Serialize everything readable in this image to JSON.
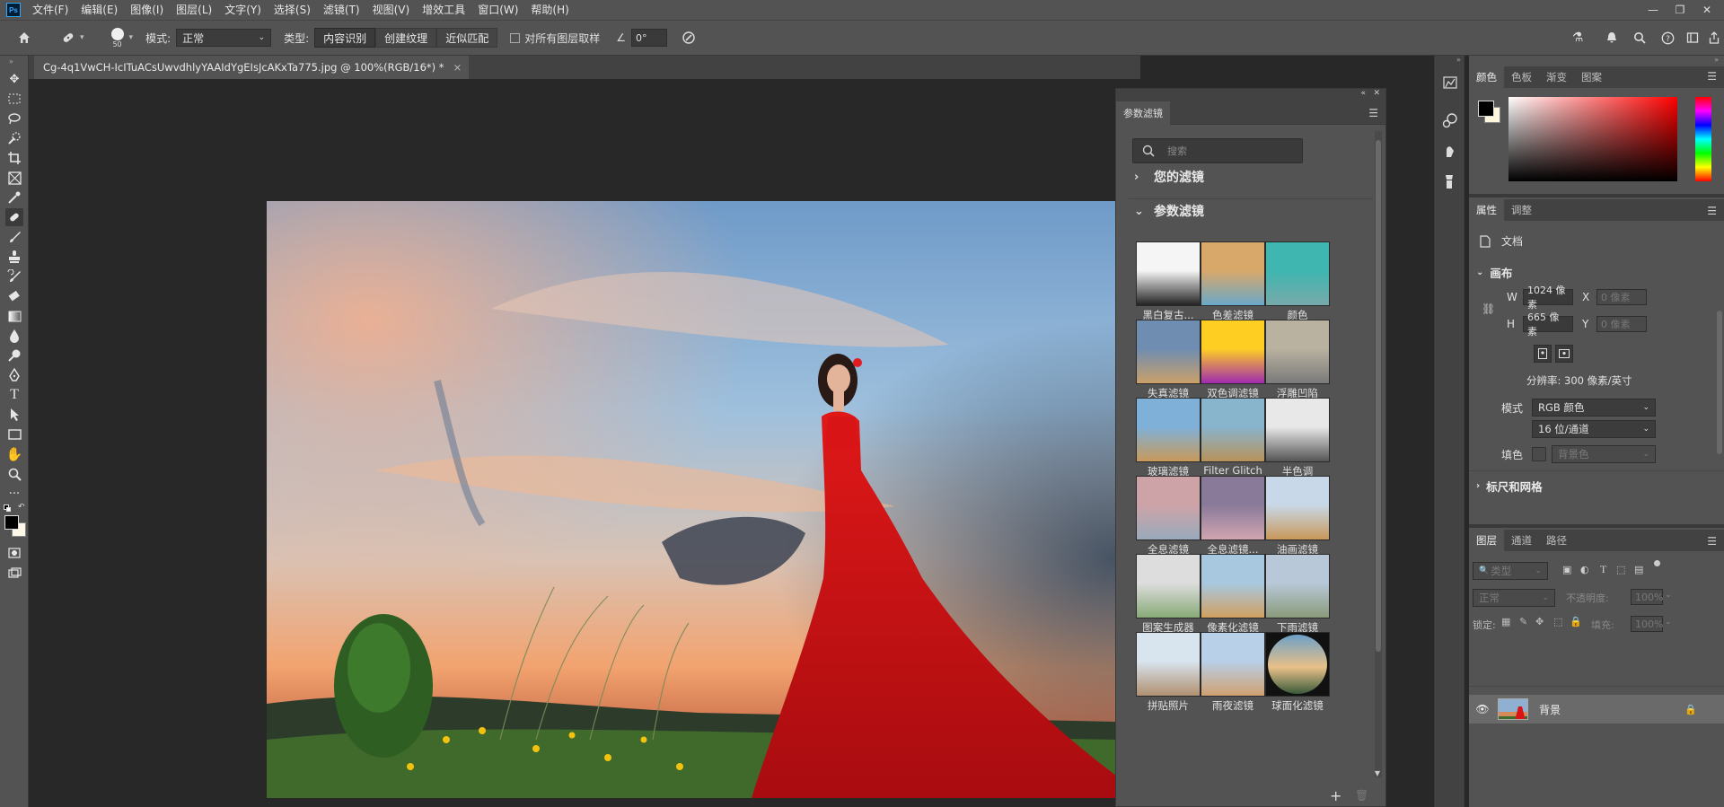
{
  "app": {
    "logo": "Ps"
  },
  "menu": [
    "文件(F)",
    "编辑(E)",
    "图像(I)",
    "图层(L)",
    "文字(Y)",
    "选择(S)",
    "滤镜(T)",
    "视图(V)",
    "增效工具",
    "窗口(W)",
    "帮助(H)"
  ],
  "window_controls": [
    "—",
    "❐",
    "✕"
  ],
  "options": {
    "brush_size": "50",
    "mode_label": "模式:",
    "mode_value": "正常",
    "type_label": "类型:",
    "type_buttons": [
      "内容识别",
      "创建纹理",
      "近似匹配"
    ],
    "sample_all_label": "对所有图层取样",
    "angle_value": "0°"
  },
  "document": {
    "tab_title": "Cg-4q1VwCH-IcITuACsUwvdhlyYAAIdYgEIsJcAKxTa775.jpg @ 100%(RGB/16*) *",
    "close": "×"
  },
  "filter_panel": {
    "tab": "参数滤镜",
    "search_placeholder": "搜索",
    "section_yours": "您的滤镜",
    "section_params": "参数滤镜",
    "filters": [
      "黑白复古...",
      "色差滤镜",
      "颜色",
      "失真滤镜",
      "双色调滤镜",
      "浮雕凹陷",
      "玻璃滤镜",
      "Filter Glitch",
      "半色调",
      "全息滤镜",
      "全息滤镜...",
      "油画滤镜",
      "图案生成器",
      "像素化滤镜",
      "下雨滤镜",
      "拼贴照片",
      "雨夜滤镜",
      "球面化滤镜"
    ],
    "add": "+",
    "trash": "🗑"
  },
  "color_panel": {
    "tabs": [
      "颜色",
      "色板",
      "渐变",
      "图案"
    ]
  },
  "properties_panel": {
    "tabs": [
      "属性",
      "调整"
    ],
    "doc_label": "文档",
    "canvas_header": "画布",
    "w_label": "W",
    "w_value": "1024 像素",
    "h_label": "H",
    "h_value": "665 像素",
    "x_label": "X",
    "x_placeholder": "0 像素",
    "y_label": "Y",
    "y_placeholder": "0 像素",
    "resolution": "分辨率: 300 像素/英寸",
    "mode_label": "模式",
    "mode_value": "RGB 颜色",
    "depth_value": "16 位/通道",
    "fill_label": "填色",
    "fill_value": "背景色",
    "rulers_header": "标尺和网格"
  },
  "layers_panel": {
    "tabs": [
      "图层",
      "通道",
      "路径"
    ],
    "filter_kind": "类型",
    "blend_mode": "正常",
    "opacity_label": "不透明度:",
    "opacity_value": "100%",
    "lock_label": "锁定:",
    "fill_label": "填充:",
    "fill_value": "100%",
    "layer_name": "背景"
  }
}
